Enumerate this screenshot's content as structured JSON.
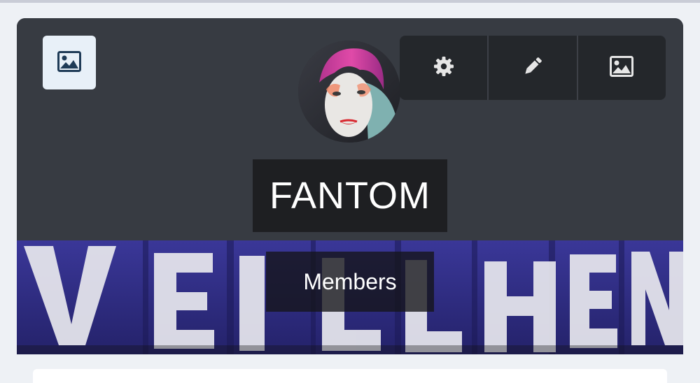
{
  "profile": {
    "name": "FANTOM",
    "members_label": "Members"
  },
  "icons": {
    "cover_toggle": "image-icon",
    "settings": "gear-icon",
    "edit": "pencil-icon",
    "change_image": "image-icon"
  },
  "colors": {
    "header_bg": "#373b42",
    "action_bg": "#24272b",
    "name_bg": "#1e1f22",
    "toggle_bg": "#e8f0f8",
    "icon_dark": "#1f3b57",
    "banner_bg": "#2c2a78"
  }
}
